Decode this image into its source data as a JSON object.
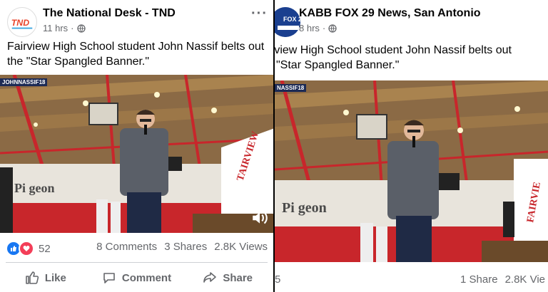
{
  "left_post": {
    "page_name": "The National Desk - TND",
    "avatar_text": "TND",
    "time": "11 hrs",
    "caption_line1": "Fairview High School student John Nassif belts out",
    "caption_line2": "the \"Star Spangled Banner.\"",
    "video_tag": "JOHNNASSIF18",
    "banner_text": "TAIRVIEW",
    "wall_text": "Pi geon",
    "reaction_count": "52",
    "comments": "8 Comments",
    "shares": "3 Shares",
    "views": "2.8K Views",
    "actions": {
      "like": "Like",
      "comment": "Comment",
      "share": "Share"
    }
  },
  "right_post": {
    "page_name": "KABB FOX 29 News, San Antonio",
    "avatar_text": "FOX 29",
    "time": "8 hrs",
    "caption_line1": "rview High School student John Nassif belts out",
    "caption_line2": "\"Star Spangled Banner.\"",
    "video_tag": "NASSIF18",
    "banner_text": "FAIRVIE",
    "wall_text": "Pi geon",
    "reaction_count_partial": "5",
    "shares": "1 Share",
    "views_partial": "2.8K Vie"
  },
  "colors": {
    "facebook_blue": "#1877f2",
    "love_red": "#f33e58",
    "meta_gray": "#65676b",
    "gym_red": "#c8262b"
  }
}
